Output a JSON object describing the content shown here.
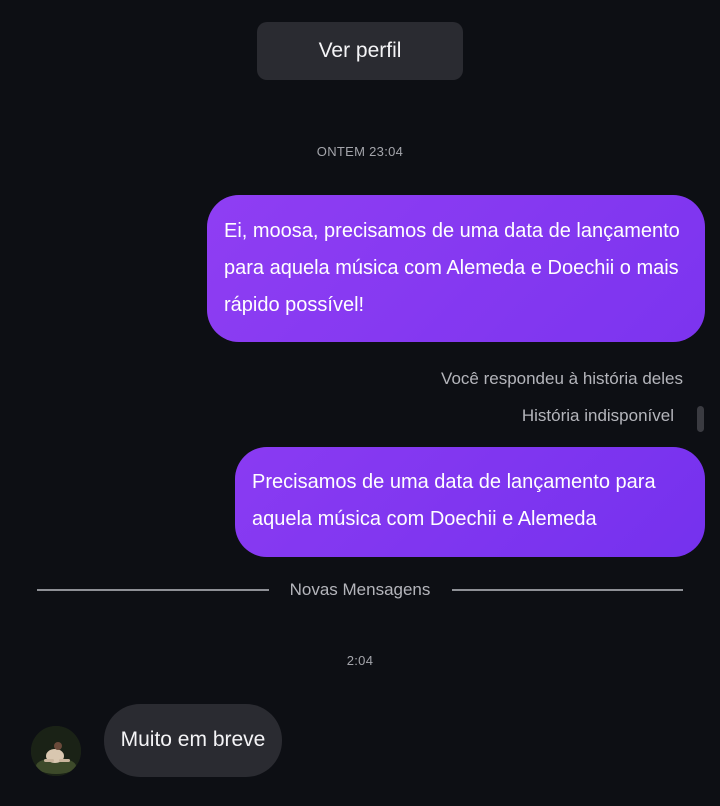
{
  "header": {
    "view_profile_label": "Ver perfil"
  },
  "timestamps": {
    "first": "ONTEM 23:04",
    "second": "2:04"
  },
  "messages": {
    "outgoing_1": "Ei, moosa, precisamos de uma data de lançamento para aquela música com Alemeda e Doechii o mais rápido possível!",
    "outgoing_2": "Precisamos de uma data de lançamento para aquela música com Doechii e Alemeda",
    "incoming_1": "Muito em breve"
  },
  "story": {
    "replied_label": "Você respondeu à história deles",
    "unavailable_label": "História indisponível"
  },
  "divider": {
    "label": "Novas Mensagens"
  },
  "colors": {
    "background": "#0d0f14",
    "outgoing_bubble": "#8a3bf2",
    "incoming_bubble": "#2a2b31",
    "secondary_text": "#b4b5bb"
  },
  "icons": {
    "avatar": "contact-avatar"
  }
}
